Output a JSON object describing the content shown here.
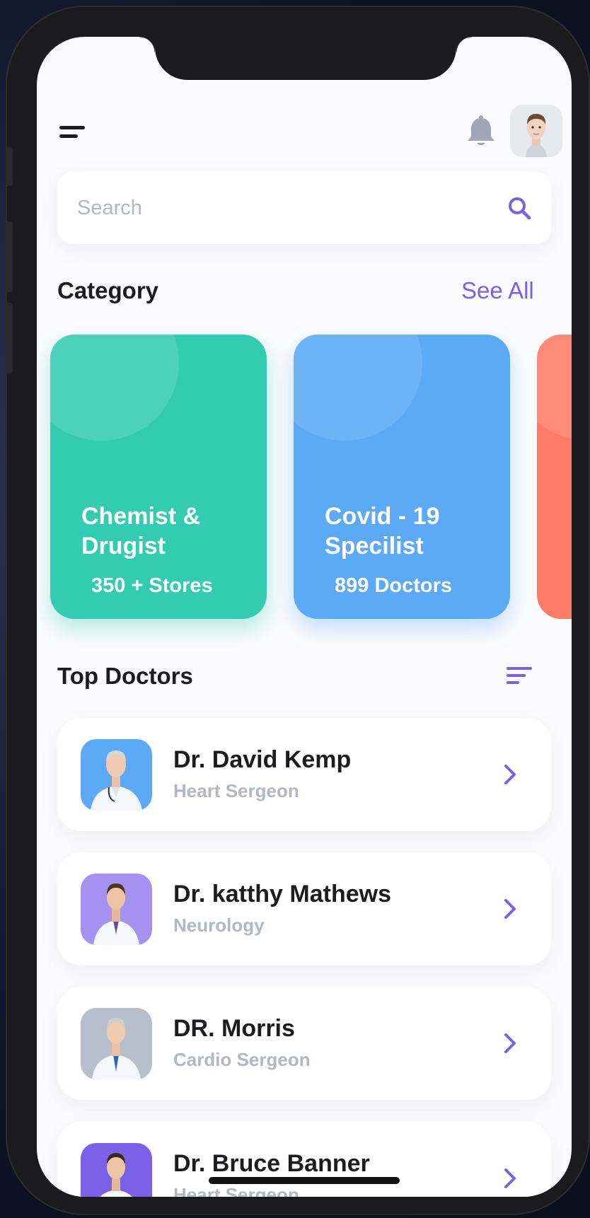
{
  "header": {
    "menu_icon": "menu-icon",
    "bell_icon": "bell-icon",
    "avatar": "user-avatar"
  },
  "search": {
    "placeholder": "Search",
    "icon": "search-icon"
  },
  "category": {
    "title": "Category",
    "see_all": "See All",
    "cards": [
      {
        "title": "Chemist & Drugist",
        "count": "350 + Stores",
        "color": "#34ccb1"
      },
      {
        "title": "Covid - 19 Specilist",
        "count": "899 Doctors",
        "color": "#5ca9f6"
      },
      {
        "title": "",
        "count": "",
        "color": "#fd7b66"
      }
    ]
  },
  "top_doctors": {
    "title": "Top Doctors",
    "sort_icon": "sort-icon",
    "doctors": [
      {
        "name": "Dr. David Kemp",
        "specialty": "Heart Sergeon",
        "photo_bg": "#5ca9f6"
      },
      {
        "name": "Dr. katthy Mathews",
        "specialty": "Neurology",
        "photo_bg": "#a592f0"
      },
      {
        "name": "DR. Morris",
        "specialty": "Cardio Sergeon",
        "photo_bg": "#b8bfcc"
      },
      {
        "name": "Dr. Bruce Banner",
        "specialty": "Heart Sergeon",
        "photo_bg": "#7b61e8"
      }
    ]
  },
  "colors": {
    "accent": "#7b61e8",
    "text_primary": "#1c1c1e",
    "text_secondary": "#b2b6c7"
  }
}
